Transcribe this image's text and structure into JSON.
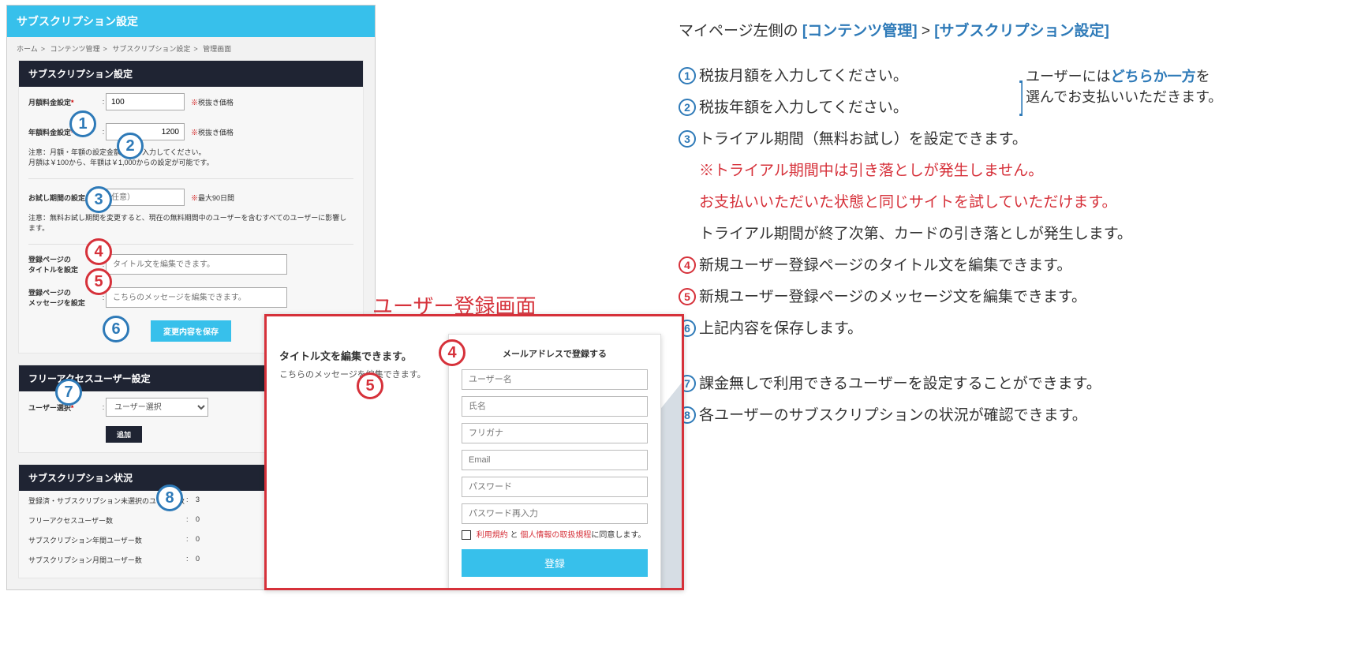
{
  "app": {
    "header": "サブスクリプション設定",
    "breadcrumb": [
      "ホーム",
      "コンテンツ管理",
      "サブスクリプション設定",
      "管理画面"
    ],
    "section1": {
      "title": "サブスクリプション設定",
      "monthly_label": "月額料金設定",
      "monthly_value": "100",
      "monthly_hint": "税抜き価格",
      "yearly_label": "年額料金設定",
      "yearly_value": "1200",
      "yearly_hint": "税抜き価格",
      "note1": "注意：月額・年額の設定金額を必ず入力してください。\n月額は￥100から、年額は￥1,000からの設定が可能です。",
      "trial_label": "お試し期間の設定",
      "trial_placeholder": "任意）",
      "trial_hint": "最大90日間",
      "note2": "注意：無料お試し期間を変更すると、現在の無料期間中のユーザーを含むすべてのユーザーに影響します。",
      "title_label": "登録ページの\nタイトルを設定",
      "title_placeholder": "タイトル文を編集できます。",
      "msg_label": "登録ページの\nメッセージを設定",
      "msg_placeholder": "こちらのメッセージを編集できます。",
      "save": "変更内容を保存"
    },
    "section2": {
      "title": "フリーアクセスユーザー設定",
      "select_label": "ユーザー選択",
      "select_value": "ユーザー選択",
      "add": "追加"
    },
    "section3": {
      "title": "サブスクリプション状況",
      "rows": [
        {
          "k": "登録済・サブスクリプション未選択のユーザー数",
          "v": "3"
        },
        {
          "k": "フリーアクセスユーザー数",
          "v": "0"
        },
        {
          "k": "サブスクリプション年間ユーザー数",
          "v": "0"
        },
        {
          "k": "サブスクリプション月間ユーザー数",
          "v": "0"
        }
      ]
    }
  },
  "reg": {
    "heading": "ユーザー登録画面",
    "title_text": "タイトル文を編集できます。",
    "msg_text": "こちらのメッセージを編集できます。",
    "form_header": "メールアドレスで登録する",
    "fields": [
      "ユーザー名",
      "氏名",
      "フリガナ",
      "Email",
      "パスワード",
      "パスワード再入力"
    ],
    "agree_pre": "",
    "agree_link1": "利用規約",
    "agree_mid": " と ",
    "agree_link2": "個人情報の取扱規程",
    "agree_post": "に同意します。",
    "submit": "登録"
  },
  "inst": {
    "head_pre": "マイページ左側の ",
    "head_l1": "[コンテンツ管理]",
    "head_sep": " > ",
    "head_l2": "[サブスクリプション設定]",
    "items": [
      "税抜月額を入力してください。",
      "税抜年額を入力してください。",
      "トライアル期間（無料お試し）を設定できます。",
      "新規ユーザー登録ページのタイトル文を編集できます。",
      "新規ユーザー登録ページのメッセージ文を編集できます。",
      "上記内容を保存します。",
      "課金無しで利用できるユーザーを設定することができます。",
      "各ユーザーのサブスクリプションの状況が確認できます。"
    ],
    "sub": [
      "※トライアル期間中は引き落としが発生しません。",
      "お支払いいただいた状態と同じサイトを試していただけます。",
      "トライアル期間が終了次第、カードの引き落としが発生します。"
    ],
    "bracket_l1": "ユーザーには",
    "bracket_em": "どちらか一方",
    "bracket_l2": "を",
    "bracket_l3": "選んでお支払いいただきます。"
  }
}
